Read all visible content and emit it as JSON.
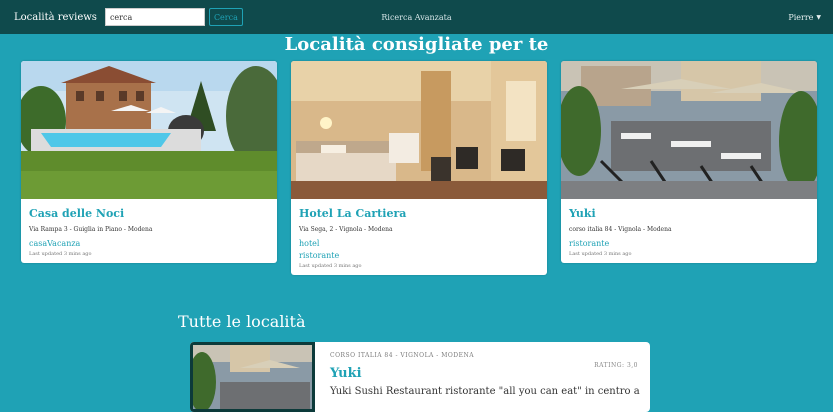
{
  "navbar": {
    "brand": "Località reviews",
    "search": {
      "value": "cerca",
      "placeholder": "cerca"
    },
    "search_button": "Cerca",
    "advanced_search": "Ricerca Avanzata",
    "user": "Pierre"
  },
  "recommended": {
    "title": "Località consigliate per te",
    "cards": [
      {
        "name": "Casa delle Noci",
        "address": "Via Rampa 3 - Guiglia in Piano - Modena",
        "tags": [
          "casaVacanza"
        ],
        "updated": "Last updated 3 mins ago"
      },
      {
        "name": "Hotel La Cartiera",
        "address": "Via Sega, 2 - Vignola - Modena",
        "tags": [
          "hotel",
          "ristorante"
        ],
        "updated": "Last updated 3 mins ago"
      },
      {
        "name": "Yuki",
        "address": "corso italia 84 - Vignola - Modena",
        "tags": [
          "ristorante"
        ],
        "updated": "Last updated 3 mins ago"
      }
    ]
  },
  "all_places": {
    "title": "Tutte le località",
    "items": [
      {
        "address": "CORSO ITALIA 84 - VIGNOLA - MODENA",
        "rating": "RATING: 3,0",
        "name": "Yuki",
        "description": "Yuki Sushi Restaurant ristorante \"all you can eat\" in centro a"
      }
    ]
  },
  "colors": {
    "page_background": "#1fa2b5",
    "navbar": "#0f4a4c",
    "accent": "#1fa2b5"
  }
}
